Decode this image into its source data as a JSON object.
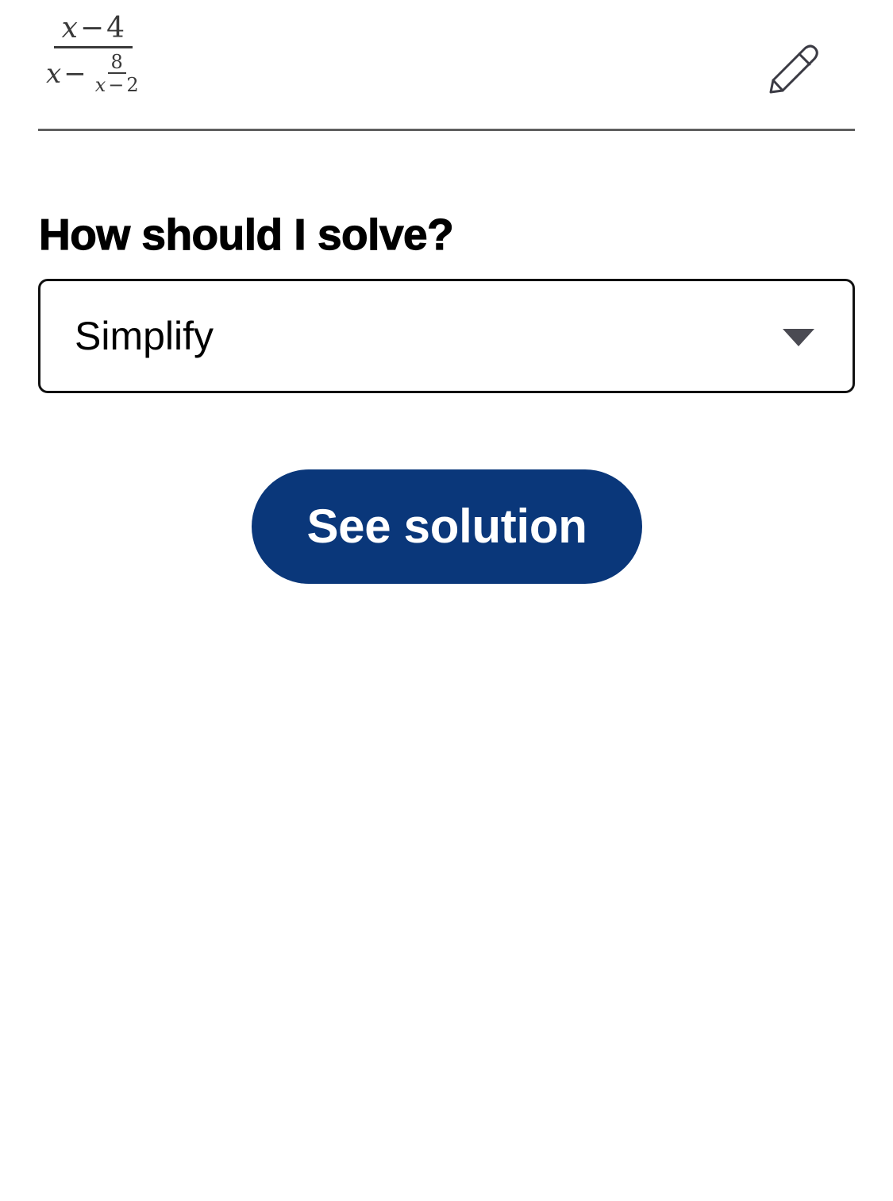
{
  "expression": {
    "numerator": {
      "variable": "x",
      "operator": "−",
      "constant": "4"
    },
    "denominator": {
      "variable": "x",
      "operator": "−",
      "fraction": {
        "numerator": "8",
        "denominator": {
          "variable": "x",
          "operator": "−",
          "constant": "2"
        }
      }
    }
  },
  "edit_icon": "pencil-icon",
  "question": "How should I solve?",
  "method_select": {
    "selected": "Simplify",
    "arrow_icon": "caret-down-icon"
  },
  "solve_button": {
    "label": "See solution"
  },
  "colors": {
    "button_bg": "#0a377a",
    "button_text": "#ffffff",
    "divider": "#5f5f5f",
    "icon": "#3b3b44"
  }
}
